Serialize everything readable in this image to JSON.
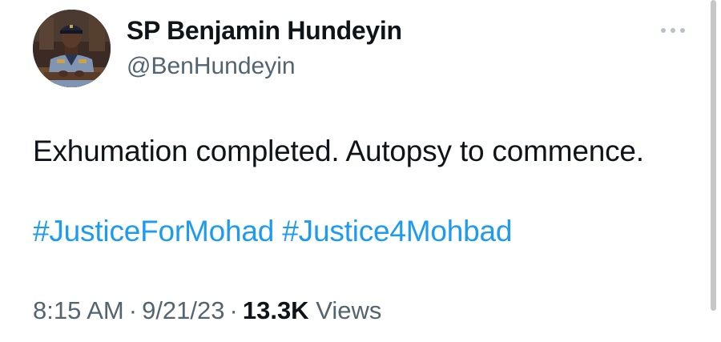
{
  "author": {
    "display_name": "SP Benjamin Hundeyin",
    "handle": "@BenHundeyin"
  },
  "tweet": {
    "text": "Exhumation completed. Autopsy to commence.",
    "hashtags": [
      "#JusticeForMohad",
      "#Justice4Mohbad"
    ],
    "time": "8:15 AM",
    "separator": "·",
    "date": "9/21/23",
    "views_count": "13.3K",
    "views_label": "Views"
  },
  "icons": {
    "more": "more-horizontal-icon",
    "avatar": "user-avatar"
  },
  "colors": {
    "text": "#0f1419",
    "secondary": "#536471",
    "link": "#1d9bf0"
  }
}
